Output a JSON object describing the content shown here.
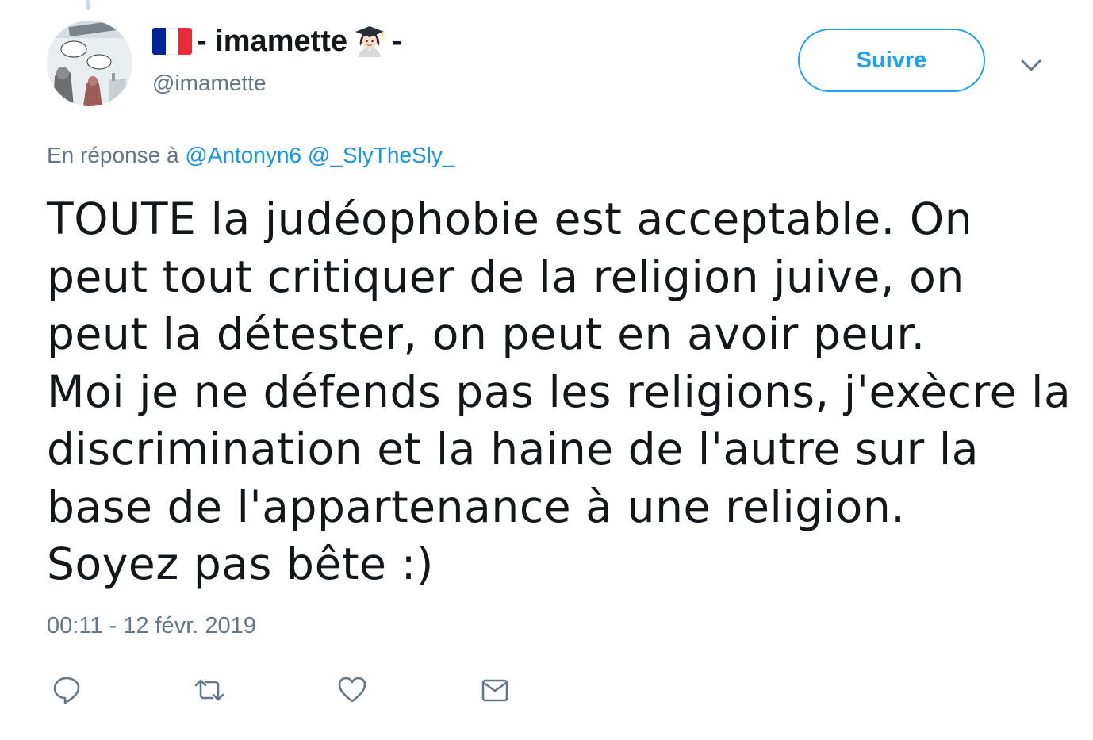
{
  "author": {
    "display_name_prefix": "- imamette",
    "display_name_suffix": "-",
    "handle": "@imamette",
    "flag_colors": [
      "#002395",
      "#ffffff",
      "#ed2939"
    ]
  },
  "follow_button": {
    "label": "Suivre"
  },
  "reply_context": {
    "prefix": "En réponse à",
    "mentions": [
      "@Antonyn6",
      "@_SlyTheSly_"
    ]
  },
  "tweet": {
    "lines": [
      "TOUTE la judéophobie est acceptable. On",
      "peut tout critiquer de la religion juive, on",
      "peut la détester, on peut en avoir peur.",
      "Moi je ne défends pas les religions, j'exècre la",
      "discrimination et la haine de l'autre sur la",
      "base de l'appartenance à une religion.",
      "Soyez pas bête :)"
    ]
  },
  "timestamp": "00:11 - 12 févr. 2019",
  "actions": {
    "icons": [
      "reply-icon",
      "retweet-icon",
      "like-icon",
      "direct-message-icon"
    ]
  },
  "colors": {
    "accent": "#1da1f2",
    "link": "#1b95e0",
    "muted": "#657786",
    "text": "#14171a",
    "icon": "#657786"
  }
}
